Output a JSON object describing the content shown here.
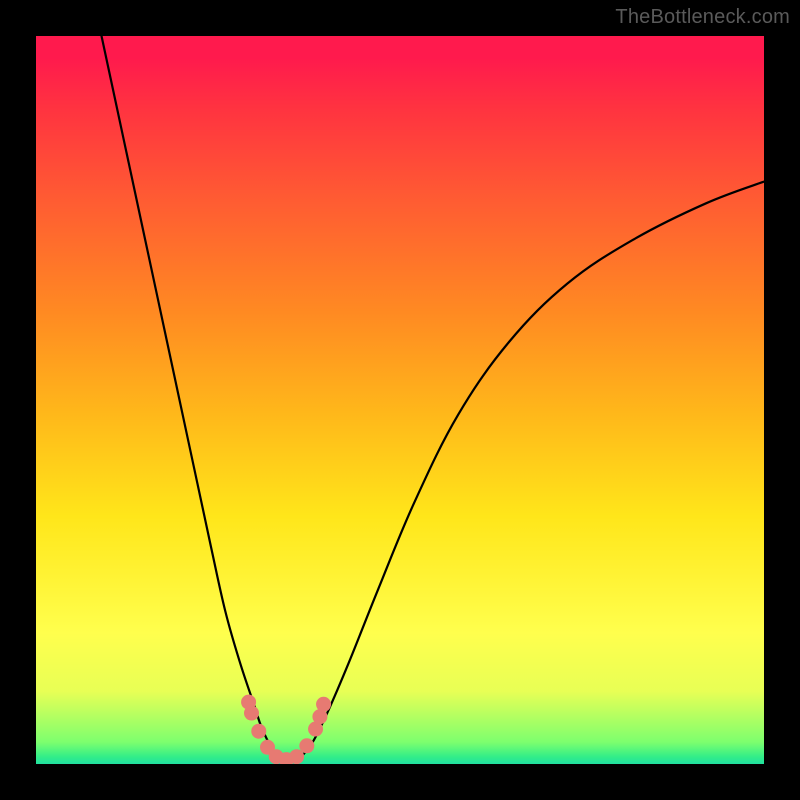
{
  "watermark": {
    "text": "TheBottleneck.com"
  },
  "colors": {
    "background": "#000000",
    "curve_stroke": "#000000",
    "marker_fill": "#e77a72",
    "gradient_stops": [
      "#ff1a4d",
      "#ff3340",
      "#ff5a33",
      "#ff8a22",
      "#ffb81a",
      "#ffe61a",
      "#ffff4d",
      "#e8ff55",
      "#7dff6e",
      "#33ee88",
      "#20e0a0"
    ]
  },
  "chart_data": {
    "type": "line",
    "title": "",
    "xlabel": "",
    "ylabel": "",
    "xlim": [
      0,
      100
    ],
    "ylim": [
      0,
      100
    ],
    "grid": false,
    "notes": "Two smooth curves forming a V-shape valley near x≈33; values dip to ~0 at the valley and rise steeply to either side. Salmon markers cluster near the valley floor.",
    "series": [
      {
        "name": "left-branch",
        "x": [
          9,
          12,
          15,
          18,
          21,
          24,
          26,
          28,
          30,
          31,
          32.5,
          34
        ],
        "y": [
          100,
          86,
          72,
          58,
          44,
          30,
          21,
          14,
          8,
          5,
          2,
          0.5
        ]
      },
      {
        "name": "right-branch",
        "x": [
          36,
          38,
          40,
          43,
          47,
          52,
          58,
          65,
          73,
          82,
          92,
          100
        ],
        "y": [
          0.5,
          3,
          7,
          14,
          24,
          36,
          48,
          58,
          66,
          72,
          77,
          80
        ]
      }
    ],
    "markers": {
      "name": "valley-points",
      "x": [
        29.2,
        29.6,
        30.6,
        31.8,
        33.0,
        34.4,
        35.8,
        37.2,
        38.4,
        39.0,
        39.5
      ],
      "y": [
        8.5,
        7.0,
        4.5,
        2.3,
        1.0,
        0.6,
        1.0,
        2.5,
        4.8,
        6.5,
        8.2
      ]
    }
  }
}
